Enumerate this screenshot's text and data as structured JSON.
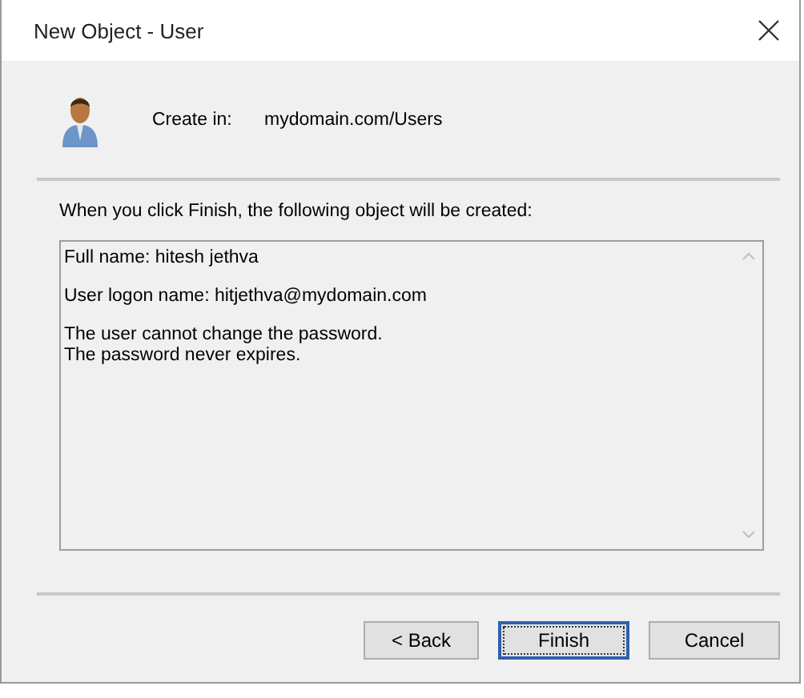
{
  "window": {
    "title": "New Object - User"
  },
  "header": {
    "label": "Create in:",
    "value": "mydomain.com/Users"
  },
  "intro": "When you click Finish, the following object will be created:",
  "summary": {
    "paragraphs": [
      [
        "Full name: hitesh jethva"
      ],
      [
        "User logon name: hitjethva@mydomain.com"
      ],
      [
        "The user cannot change the password.",
        "The password never expires."
      ]
    ]
  },
  "buttons": [
    {
      "label": "< Back",
      "default": false
    },
    {
      "label": "Finish",
      "default": true
    },
    {
      "label": "Cancel",
      "default": false
    }
  ]
}
